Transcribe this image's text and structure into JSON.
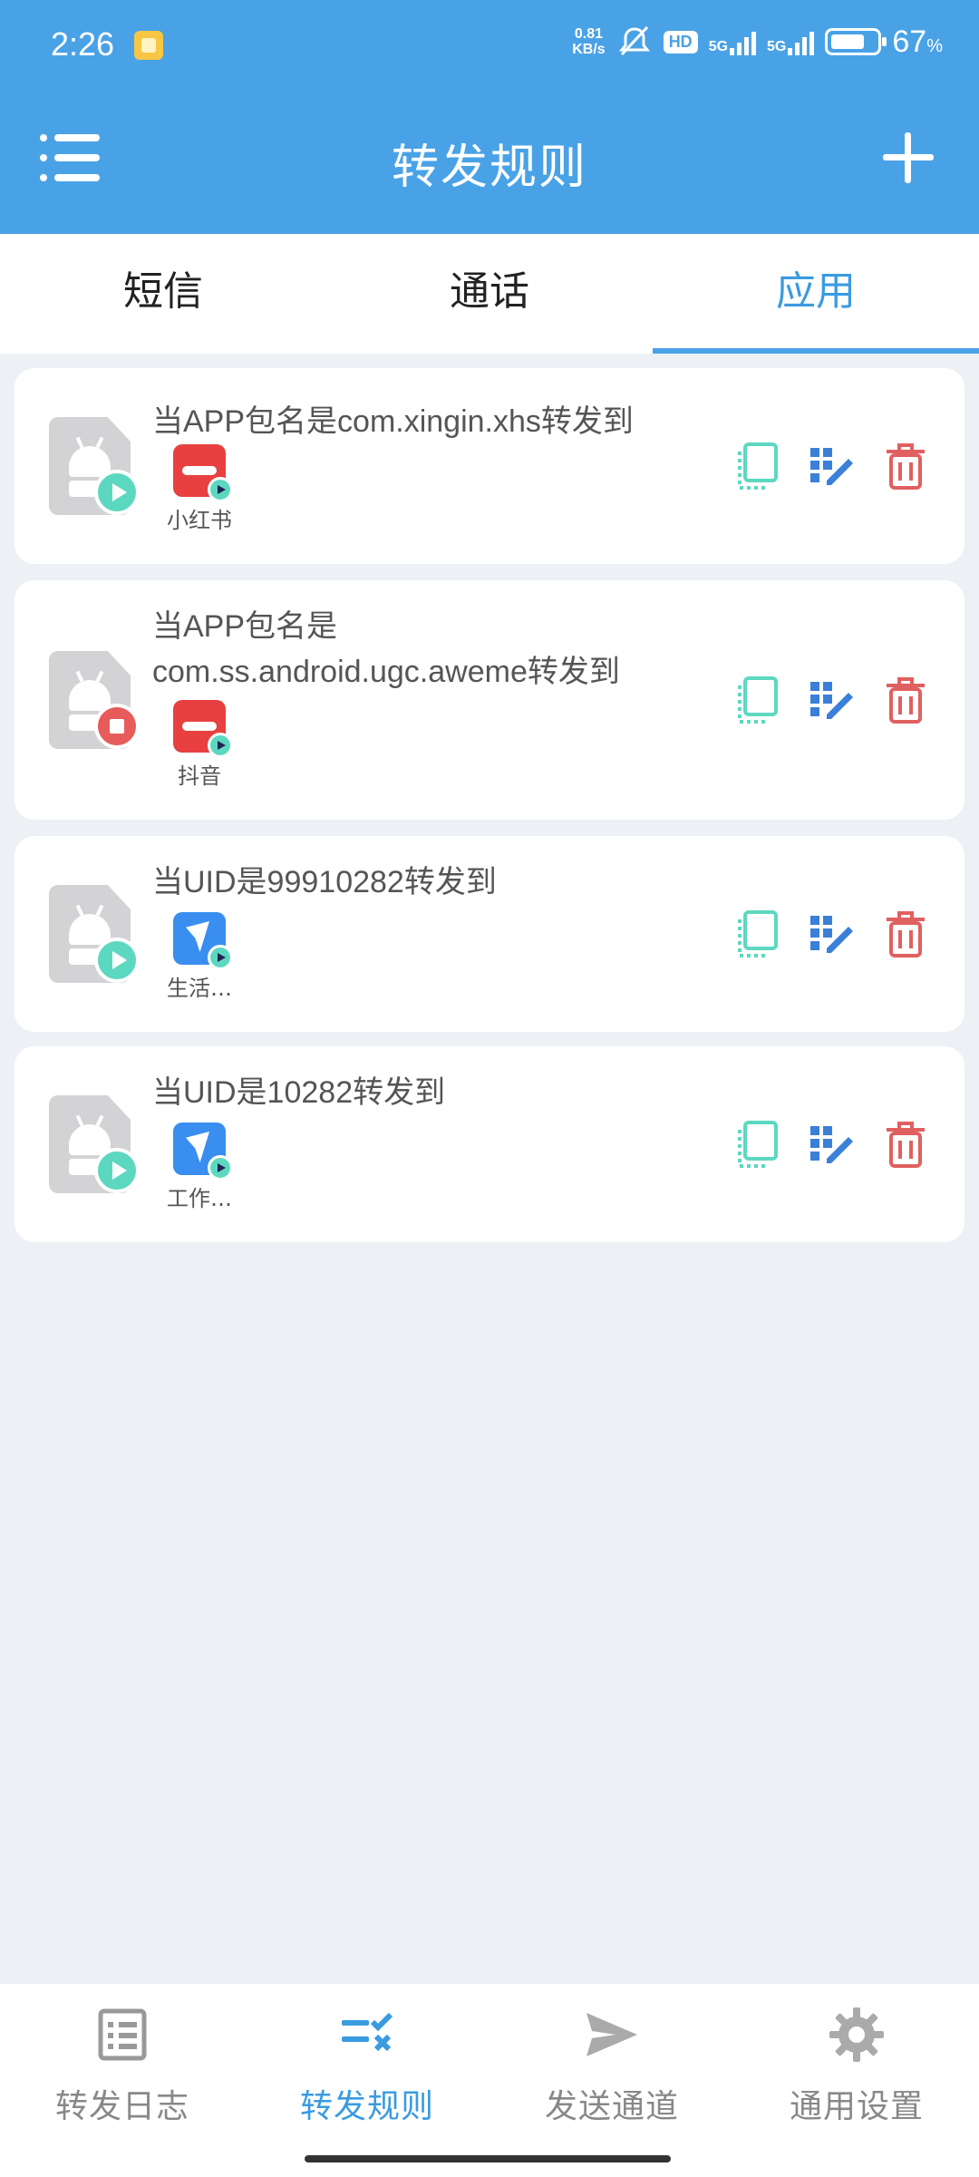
{
  "status_bar": {
    "time": "2:26",
    "speed_top": "0.81",
    "speed_bottom": "KB/s",
    "hd": "HD",
    "sig1": "5G",
    "sig2": "5G",
    "battery_pct": "67",
    "battery_unit": "%"
  },
  "header": {
    "title": "转发规则",
    "menu_icon": "menu-list-icon",
    "add_icon": "plus-icon"
  },
  "tabs": [
    {
      "label": "短信",
      "active": false
    },
    {
      "label": "通话",
      "active": false
    },
    {
      "label": "应用",
      "active": true
    }
  ],
  "rules": [
    {
      "text": "当APP包名是com.xingin.xhs转发到",
      "status": "running",
      "target_label": "小红书",
      "target_color": "#e84040"
    },
    {
      "text": "当APP包名是\ncom.ss.android.ugc.aweme转发到",
      "status": "stopped",
      "target_label": "抖音",
      "target_color": "#e84040"
    },
    {
      "text": "当UID是99910282转发到",
      "status": "running",
      "target_label": "生活…",
      "target_color": "#3a8ef0"
    },
    {
      "text": "当UID是10282转发到",
      "status": "running",
      "target_label": "工作…",
      "target_color": "#3a8ef0"
    }
  ],
  "rule_actions": [
    "copy-icon",
    "edit-icon",
    "delete-icon"
  ],
  "colors": {
    "accent": "#4aa2e6",
    "teal": "#5dd8c0",
    "delete": "#e06060",
    "edit": "#3a7fd8"
  },
  "bottom_nav": [
    {
      "label": "转发日志",
      "icon": "log-list-icon",
      "active": false
    },
    {
      "label": "转发规则",
      "icon": "rules-icon",
      "active": true
    },
    {
      "label": "发送通道",
      "icon": "send-icon",
      "active": false
    },
    {
      "label": "通用设置",
      "icon": "gear-icon",
      "active": false
    }
  ]
}
